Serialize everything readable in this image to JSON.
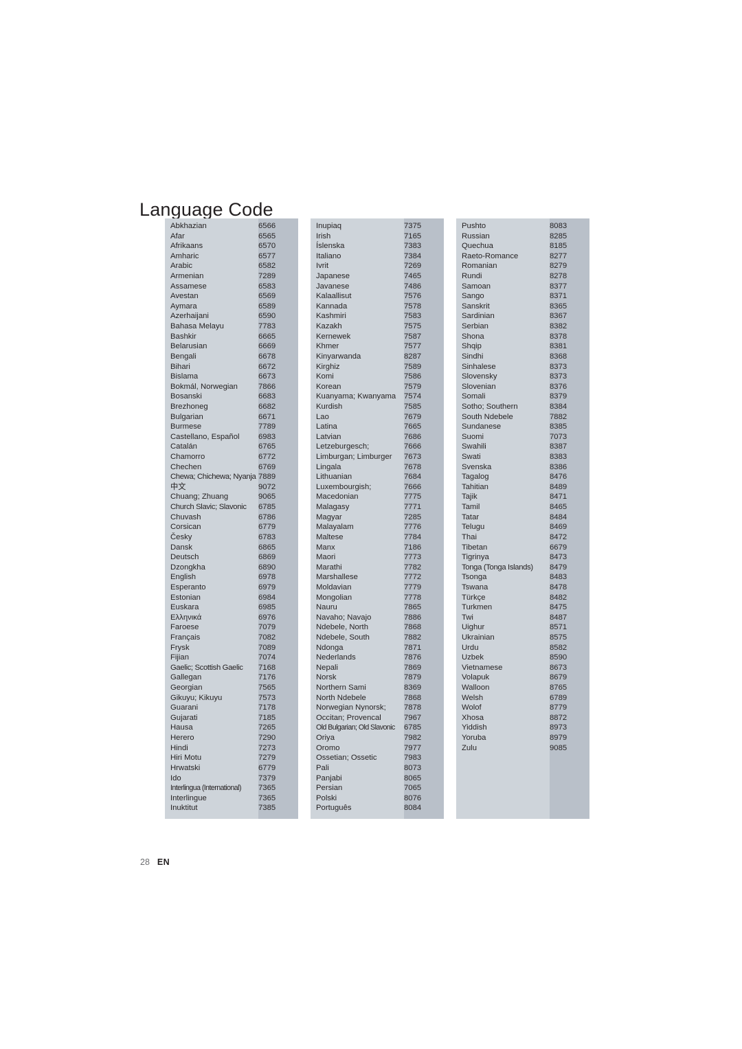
{
  "title": "Language Code",
  "footer": {
    "page_number": "28",
    "language": "EN"
  },
  "columns": [
    {
      "rows": [
        {
          "name": "Abkhazian",
          "code": "6566"
        },
        {
          "name": "Afar",
          "code": "6565"
        },
        {
          "name": "Afrikaans",
          "code": "6570"
        },
        {
          "name": "Amharic",
          "code": "6577"
        },
        {
          "name": "Arabic",
          "code": "6582"
        },
        {
          "name": "Armenian",
          "code": "7289"
        },
        {
          "name": "Assamese",
          "code": "6583"
        },
        {
          "name": "Avestan",
          "code": "6569"
        },
        {
          "name": "Aymara",
          "code": "6589"
        },
        {
          "name": "Azerhaijani",
          "code": "6590"
        },
        {
          "name": "Bahasa Melayu",
          "code": "7783"
        },
        {
          "name": "Bashkir",
          "code": "6665"
        },
        {
          "name": "Belarusian",
          "code": "6669"
        },
        {
          "name": "Bengali",
          "code": "6678"
        },
        {
          "name": "Bihari",
          "code": "6672"
        },
        {
          "name": "Bislama",
          "code": "6673"
        },
        {
          "name": "Bokmál, Norwegian",
          "code": "7866"
        },
        {
          "name": "Bosanski",
          "code": "6683"
        },
        {
          "name": "Brezhoneg",
          "code": "6682"
        },
        {
          "name": "Bulgarian",
          "code": "6671"
        },
        {
          "name": "Burmese",
          "code": "7789"
        },
        {
          "name": "Castellano, Español",
          "code": "6983"
        },
        {
          "name": "Catalán",
          "code": "6765"
        },
        {
          "name": "Chamorro",
          "code": "6772"
        },
        {
          "name": "Chechen",
          "code": "6769"
        },
        {
          "name": "Chewa; Chichewa; Nyanja",
          "code": "7889"
        },
        {
          "name": "中文",
          "code": "9072"
        },
        {
          "name": "Chuang; Zhuang",
          "code": "9065"
        },
        {
          "name": "Church Slavic; Slavonic",
          "code": "6785"
        },
        {
          "name": "Chuvash",
          "code": "6786"
        },
        {
          "name": "Corsican",
          "code": "6779"
        },
        {
          "name": "Česky",
          "code": "6783"
        },
        {
          "name": "Dansk",
          "code": "6865"
        },
        {
          "name": "Deutsch",
          "code": "6869"
        },
        {
          "name": "Dzongkha",
          "code": "6890"
        },
        {
          "name": "English",
          "code": "6978"
        },
        {
          "name": "Esperanto",
          "code": "6979"
        },
        {
          "name": "Estonian",
          "code": "6984"
        },
        {
          "name": "Euskara",
          "code": "6985"
        },
        {
          "name": "Ελληνικά",
          "code": "6976"
        },
        {
          "name": "Faroese",
          "code": "7079"
        },
        {
          "name": "Français",
          "code": "7082"
        },
        {
          "name": "Frysk",
          "code": "7089"
        },
        {
          "name": "Fijian",
          "code": "7074"
        },
        {
          "name": "Gaelic; Scottish Gaelic",
          "code": "7168"
        },
        {
          "name": "Gallegan",
          "code": "7176"
        },
        {
          "name": "Georgian",
          "code": "7565"
        },
        {
          "name": "Gikuyu; Kikuyu",
          "code": "7573"
        },
        {
          "name": "Guarani",
          "code": "7178"
        },
        {
          "name": "Gujarati",
          "code": "7185"
        },
        {
          "name": "Hausa",
          "code": "7265"
        },
        {
          "name": "Herero",
          "code": "7290"
        },
        {
          "name": "Hindi",
          "code": "7273"
        },
        {
          "name": "Hiri Motu",
          "code": "7279"
        },
        {
          "name": "Hrwatski",
          "code": "6779"
        },
        {
          "name": "Ido",
          "code": "7379"
        },
        {
          "name": "Interlingua (International)",
          "code": "7365"
        },
        {
          "name": "Interlingue",
          "code": "7365"
        },
        {
          "name": "Inuktitut",
          "code": "7385"
        }
      ]
    },
    {
      "rows": [
        {
          "name": "Inupiaq",
          "code": "7375"
        },
        {
          "name": "Irish",
          "code": "7165"
        },
        {
          "name": "Íslenska",
          "code": "7383"
        },
        {
          "name": "Italiano",
          "code": "7384"
        },
        {
          "name": "Ivrit",
          "code": "7269"
        },
        {
          "name": "Japanese",
          "code": "7465"
        },
        {
          "name": "Javanese",
          "code": "7486"
        },
        {
          "name": "Kalaallisut",
          "code": "7576"
        },
        {
          "name": "Kannada",
          "code": "7578"
        },
        {
          "name": "Kashmiri",
          "code": "7583"
        },
        {
          "name": "Kazakh",
          "code": "7575"
        },
        {
          "name": "Kernewek",
          "code": "7587"
        },
        {
          "name": "Khmer",
          "code": "7577"
        },
        {
          "name": "Kinyarwanda",
          "code": "8287"
        },
        {
          "name": "Kirghiz",
          "code": "7589"
        },
        {
          "name": "Komi",
          "code": "7586"
        },
        {
          "name": "Korean",
          "code": "7579"
        },
        {
          "name": "Kuanyama; Kwanyama",
          "code": "7574"
        },
        {
          "name": "Kurdish",
          "code": "7585"
        },
        {
          "name": "Lao",
          "code": "7679"
        },
        {
          "name": "Latina",
          "code": "7665"
        },
        {
          "name": "Latvian",
          "code": "7686"
        },
        {
          "name": "Letzeburgesch;",
          "code": "7666"
        },
        {
          "name": "Limburgan; Limburger",
          "code": "7673"
        },
        {
          "name": "Lingala",
          "code": "7678"
        },
        {
          "name": "Lithuanian",
          "code": "7684"
        },
        {
          "name": "Luxembourgish;",
          "code": "7666"
        },
        {
          "name": "Macedonian",
          "code": "7775"
        },
        {
          "name": "Malagasy",
          "code": "7771"
        },
        {
          "name": "Magyar",
          "code": "7285"
        },
        {
          "name": "Malayalam",
          "code": "7776"
        },
        {
          "name": "Maltese",
          "code": "7784"
        },
        {
          "name": "Manx",
          "code": "7186"
        },
        {
          "name": "Maori",
          "code": "7773"
        },
        {
          "name": "Marathi",
          "code": "7782"
        },
        {
          "name": "Marshallese",
          "code": "7772"
        },
        {
          "name": "Moldavian",
          "code": "7779"
        },
        {
          "name": "Mongolian",
          "code": "7778"
        },
        {
          "name": "Nauru",
          "code": "7865"
        },
        {
          "name": "Navaho; Navajo",
          "code": "7886"
        },
        {
          "name": "Ndebele, North",
          "code": "7868"
        },
        {
          "name": "Ndebele, South",
          "code": "7882"
        },
        {
          "name": "Ndonga",
          "code": "7871"
        },
        {
          "name": "Nederlands",
          "code": "7876"
        },
        {
          "name": "Nepali",
          "code": "7869"
        },
        {
          "name": "Norsk",
          "code": "7879"
        },
        {
          "name": "Northern Sami",
          "code": "8369"
        },
        {
          "name": "North Ndebele",
          "code": "7868"
        },
        {
          "name": "Norwegian Nynorsk;",
          "code": "7878"
        },
        {
          "name": "Occitan; Provencal",
          "code": "7967"
        },
        {
          "name": "Old Bulgarian; Old Slavonic",
          "code": "6785"
        },
        {
          "name": "Oriya",
          "code": "7982"
        },
        {
          "name": "Oromo",
          "code": "7977"
        },
        {
          "name": "Ossetian; Ossetic",
          "code": "7983"
        },
        {
          "name": "Pali",
          "code": "8073"
        },
        {
          "name": "Panjabi",
          "code": "8065"
        },
        {
          "name": "Persian",
          "code": "7065"
        },
        {
          "name": "Polski",
          "code": "8076"
        },
        {
          "name": "Português",
          "code": "8084"
        }
      ]
    },
    {
      "rows": [
        {
          "name": "Pushto",
          "code": "8083"
        },
        {
          "name": "Russian",
          "code": "8285"
        },
        {
          "name": "Quechua",
          "code": "8185"
        },
        {
          "name": "Raeto-Romance",
          "code": "8277"
        },
        {
          "name": "Romanian",
          "code": "8279"
        },
        {
          "name": "Rundi",
          "code": "8278"
        },
        {
          "name": "Samoan",
          "code": "8377"
        },
        {
          "name": "Sango",
          "code": "8371"
        },
        {
          "name": "Sanskrit",
          "code": "8365"
        },
        {
          "name": "Sardinian",
          "code": "8367"
        },
        {
          "name": "Serbian",
          "code": "8382"
        },
        {
          "name": "Shona",
          "code": "8378"
        },
        {
          "name": "Shqip",
          "code": "8381"
        },
        {
          "name": "Sindhi",
          "code": "8368"
        },
        {
          "name": "Sinhalese",
          "code": "8373"
        },
        {
          "name": "Slovensky",
          "code": "8373"
        },
        {
          "name": "Slovenian",
          "code": "8376"
        },
        {
          "name": "Somali",
          "code": "8379"
        },
        {
          "name": "Sotho; Southern",
          "code": "8384"
        },
        {
          "name": "South Ndebele",
          "code": "7882"
        },
        {
          "name": "Sundanese",
          "code": "8385"
        },
        {
          "name": "Suomi",
          "code": "7073"
        },
        {
          "name": "Swahili",
          "code": "8387"
        },
        {
          "name": "Swati",
          "code": "8383"
        },
        {
          "name": "Svenska",
          "code": "8386"
        },
        {
          "name": "Tagalog",
          "code": "8476"
        },
        {
          "name": "Tahitian",
          "code": "8489"
        },
        {
          "name": "Tajik",
          "code": "8471"
        },
        {
          "name": "Tamil",
          "code": "8465"
        },
        {
          "name": "Tatar",
          "code": "8484"
        },
        {
          "name": "Telugu",
          "code": "8469"
        },
        {
          "name": "Thai",
          "code": "8472"
        },
        {
          "name": "Tibetan",
          "code": "6679"
        },
        {
          "name": "Tigrinya",
          "code": "8473"
        },
        {
          "name": "Tonga (Tonga Islands)",
          "code": "8479"
        },
        {
          "name": "Tsonga",
          "code": "8483"
        },
        {
          "name": "Tswana",
          "code": "8478"
        },
        {
          "name": "Türkçe",
          "code": "8482"
        },
        {
          "name": "Turkmen",
          "code": "8475"
        },
        {
          "name": "Twi",
          "code": "8487"
        },
        {
          "name": "Uighur",
          "code": "8571"
        },
        {
          "name": "Ukrainian",
          "code": "8575"
        },
        {
          "name": "Urdu",
          "code": "8582"
        },
        {
          "name": "Uzbek",
          "code": "8590"
        },
        {
          "name": "Vietnamese",
          "code": "8673"
        },
        {
          "name": "Volapuk",
          "code": "8679"
        },
        {
          "name": "Walloon",
          "code": "8765"
        },
        {
          "name": "Welsh",
          "code": "6789"
        },
        {
          "name": "Wolof",
          "code": "8779"
        },
        {
          "name": "Xhosa",
          "code": "8872"
        },
        {
          "name": "Yiddish",
          "code": "8973"
        },
        {
          "name": "Yoruba",
          "code": "8979"
        },
        {
          "name": "Zulu",
          "code": "9085"
        }
      ]
    }
  ],
  "colors": {
    "name_band": "#ced4da",
    "code_band": "#b9c0c9",
    "text": "#231f20",
    "page_background": "#ffffff"
  }
}
